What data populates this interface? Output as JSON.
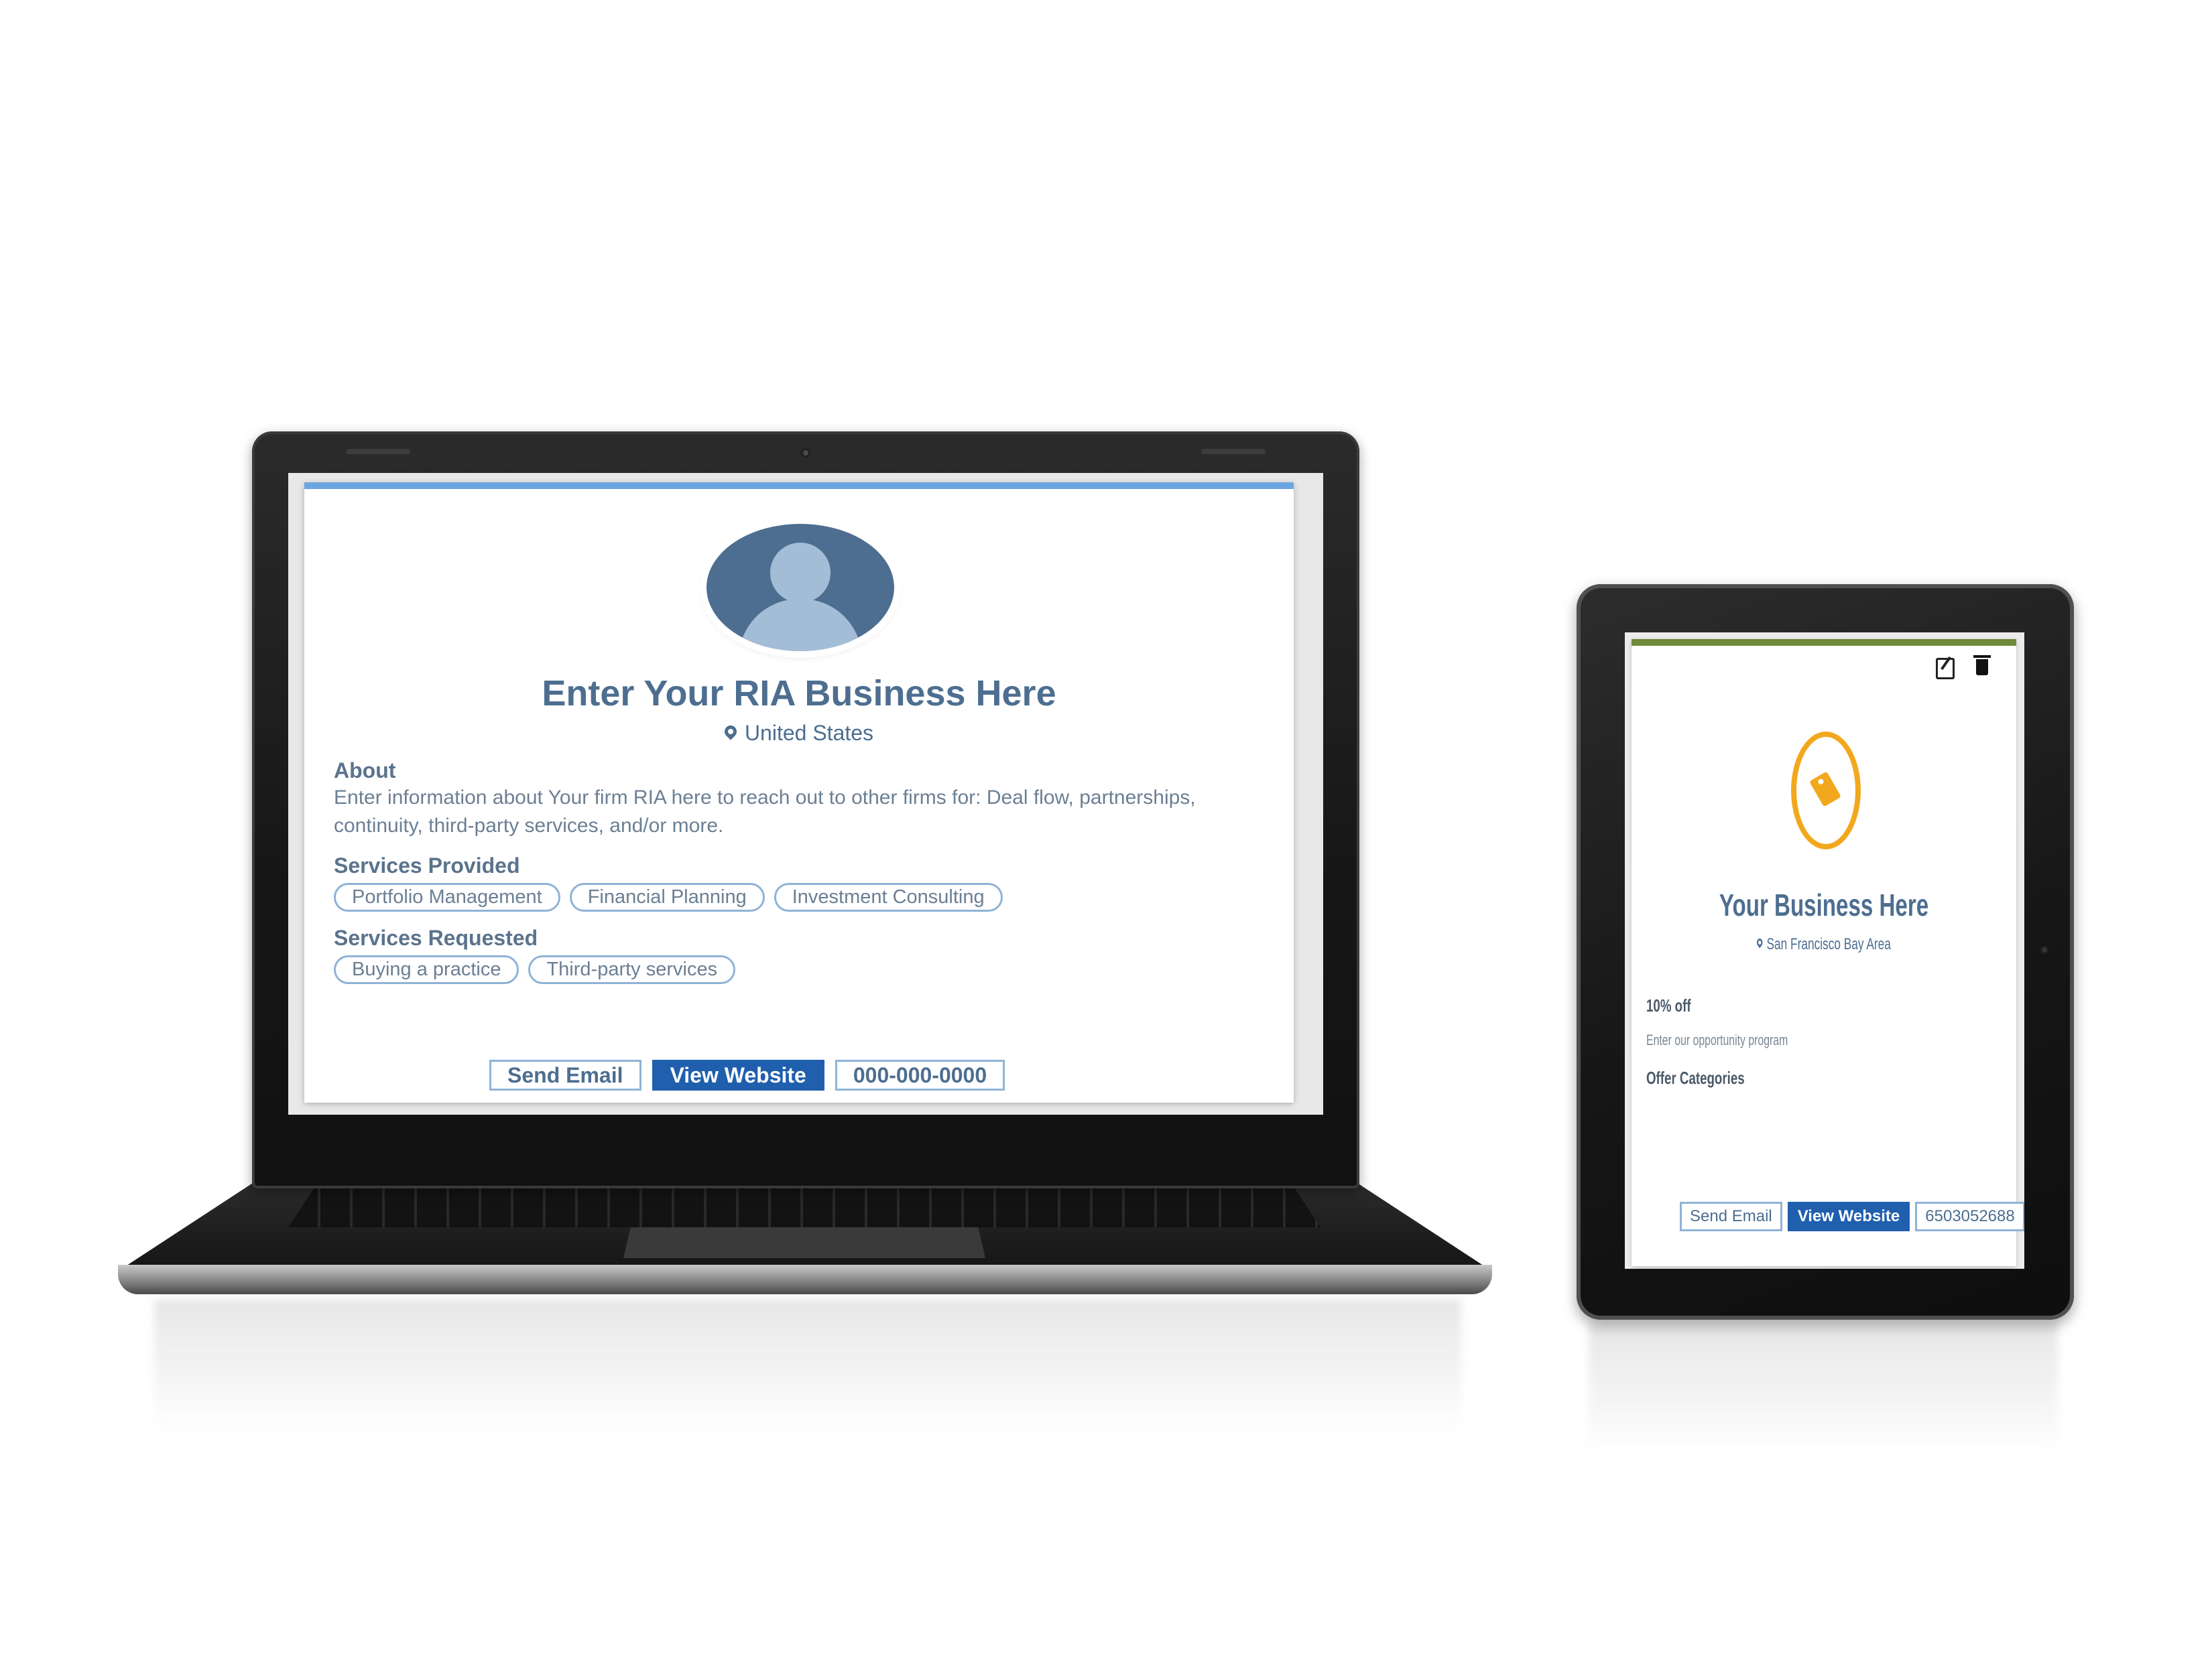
{
  "laptop": {
    "business_title": "Enter Your RIA Business Here",
    "location": "United States",
    "about_label": "About",
    "about_text": "Enter information about Your firm RIA here to reach out to other firms for: Deal flow, partnerships, continuity, third-party services, and/or more.",
    "services_provided_label": "Services Provided",
    "services_provided": [
      "Portfolio Management",
      "Financial Planning",
      "Investment Consulting"
    ],
    "services_requested_label": "Services Requested",
    "services_requested": [
      "Buying a practice",
      "Third-party services"
    ],
    "buttons": {
      "send_email": "Send Email",
      "view_website": "View Website",
      "phone": "000-000-0000"
    }
  },
  "tablet": {
    "business_title": "Your Business Here",
    "location": "San Francisco Bay Area",
    "discount": "10% off",
    "description": "Enter our opportunity program",
    "offer_categories_label": "Offer Categories",
    "buttons": {
      "send_email": "Send Email",
      "view_website": "View Website",
      "phone": "6503052688"
    }
  },
  "colors": {
    "accent_blue": "#1f5fae",
    "title_blue": "#4d6e90",
    "laptop_card_top": "#6ca6e0",
    "tablet_card_top": "#6f8a3a",
    "offer_orange": "#f2a81d"
  },
  "icons": [
    "avatar-icon",
    "map-pin-icon",
    "edit-icon",
    "trash-icon",
    "price-tag-icon"
  ]
}
